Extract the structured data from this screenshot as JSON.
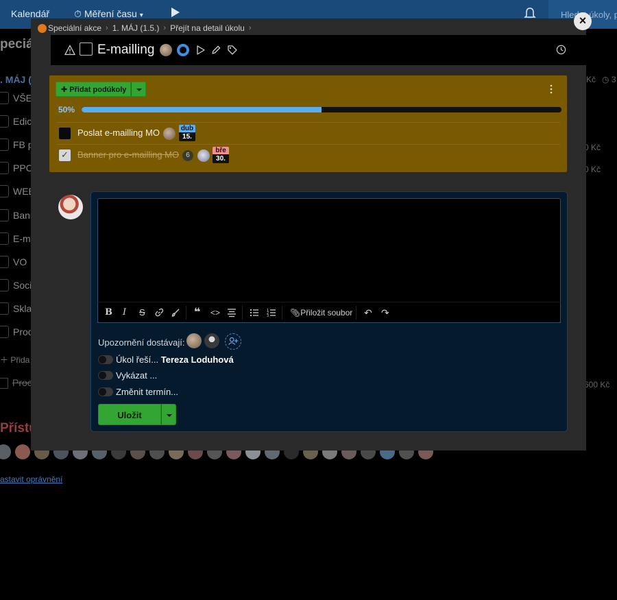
{
  "topbar": {
    "calendar_label": "Kalendář",
    "time_tracking_label": "Měření času",
    "search_placeholder": "Hledat úkoly, p"
  },
  "background": {
    "page_title": "peciál",
    "section_title": ". MÁJ (",
    "rows": [
      "VŠE",
      "Edic",
      "FB p",
      "PPC",
      "WEB",
      "Banr",
      "E-m",
      "VO",
      "Soci",
      "Skla",
      "Proc"
    ],
    "add_label": "Přida",
    "done_row": "Proc",
    "right_values": [
      "Kč",
      "3",
      "0 Kč",
      "0 Kč",
      "600 Kč"
    ],
    "access_title": "Přístu",
    "permission_link": "astavit oprávnění"
  },
  "modal": {
    "breadcrumb": {
      "project": "Speciální akce",
      "milestone": "1. MÁJ (1.5.)",
      "detail_link": "Přejít na detail úkolu"
    },
    "close_label": "×",
    "task_title": "E-mailling",
    "subtasks": {
      "add_button_label": "Přidat podúkoly",
      "progress_label": "50%",
      "progress_fraction": 0.5,
      "items": [
        {
          "text": "Poslat e-mailling MO",
          "done": false,
          "date_month": "dub",
          "date_day": "15.",
          "month_color": "#5aaef0"
        },
        {
          "text": "Banner pro e-mailling MO",
          "done": true,
          "count": "6",
          "date_month": "bře",
          "date_day": "30.",
          "month_color": "#f09090"
        }
      ]
    },
    "comment": {
      "toolbar": {
        "bold": "B",
        "italic": "I",
        "strike": "S",
        "attach_label": "Přiložit soubor"
      },
      "notify_label": "Upozornění dostávají:",
      "toggles": [
        {
          "label": "Úkol řeší...",
          "value": "Tereza Loduhová"
        },
        {
          "label": "Vykázat ...",
          "value": ""
        },
        {
          "label": "Změnit termín...",
          "value": ""
        }
      ],
      "save_label": "Uložit"
    }
  },
  "colors": {
    "accent_green": "#33a532",
    "subtask_panel": "#7a5a00",
    "progress_blue": "#5aaef0"
  }
}
